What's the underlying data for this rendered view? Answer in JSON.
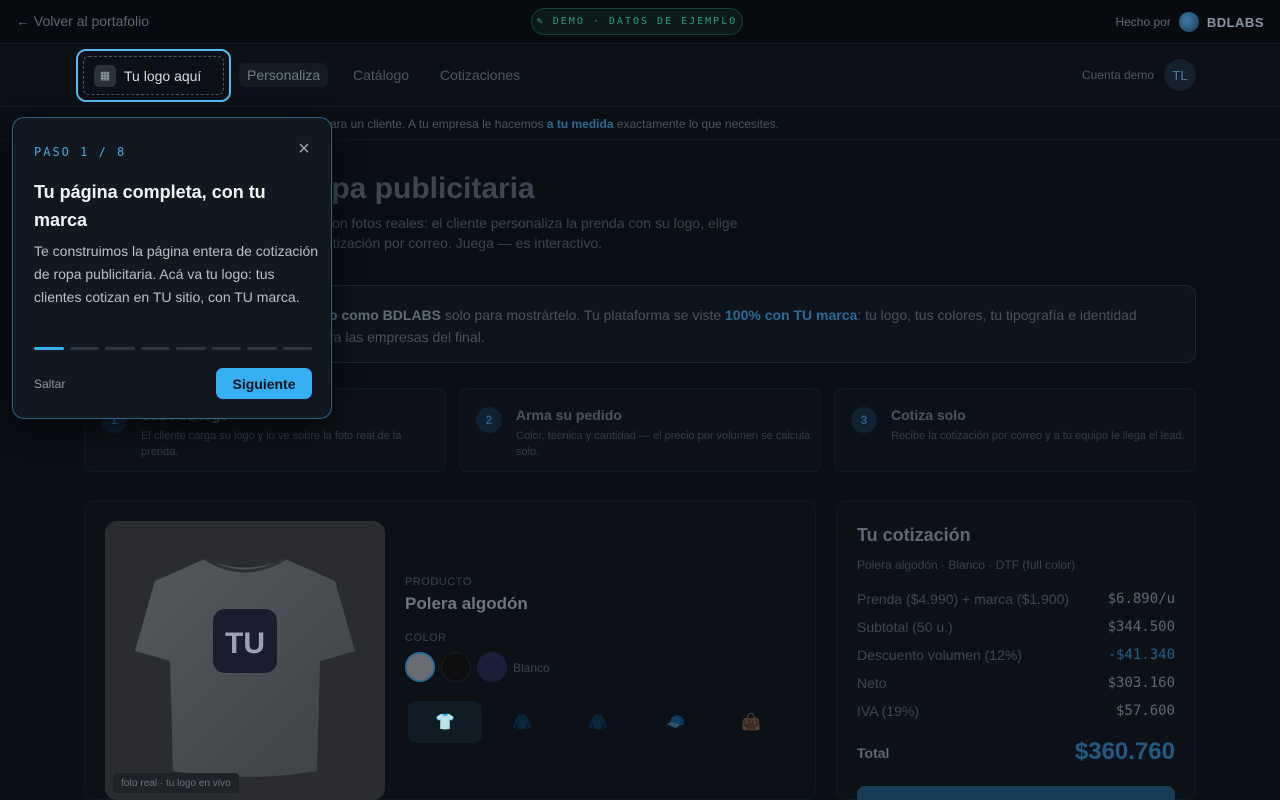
{
  "topbar": {
    "back_label": "← Volver al portafolio",
    "demo_badge": "DEMO · DATOS DE EJEMPLO",
    "made_by": "Hecho por",
    "brand": "BDLABS"
  },
  "nav": {
    "logo_placeholder": "Tu logo aquí",
    "items": [
      "Personaliza",
      "Catálogo",
      "Cotizaciones"
    ],
    "account": "Cuenta demo",
    "avatar_initials": "TL"
  },
  "notice": {
    "text_a": "s para un cliente. A tu empresa le hacemos ",
    "text_b": "a tu medida",
    "text_c": " exactamente lo que necesites."
  },
  "hero": {
    "title": "opa publicitaria",
    "subtitle_a": "con fotos reales: el cliente personaliza la prenda con su logo, elige",
    "subtitle_b": "otización por correo. Juega — es interactivo."
  },
  "banner": {
    "a": "o como BDLABS",
    "b": " solo para mostrártelo. Tu plataforma se viste ",
    "c": "100% con TU marca",
    "d": ": tu logo, tus colores, tu tipografía e identidad",
    "e": "ra las empresas del final."
  },
  "steps": [
    {
      "num": "1",
      "title": "Sube su logo",
      "desc": "El cliente carga su logo y lo ve sobre la foto real de la prenda."
    },
    {
      "num": "2",
      "title": "Arma su pedido",
      "desc": "Color, técnica y cantidad — el precio por volumen se calcula solo."
    },
    {
      "num": "3",
      "title": "Cotiza solo",
      "desc": "Recibe la cotización por correo y a tu equipo le llega el lead."
    }
  ],
  "product": {
    "photo_tag": "foto real · tu logo en vivo",
    "logo_text": "TU",
    "label": "PRODUCTO",
    "name": "Polera algodón",
    "color_label": "COLOR",
    "color_name": "Blanco"
  },
  "quote": {
    "title": "Tu cotización",
    "subtitle": "Polera algodón · Blanco · DTF (full color)",
    "rows": [
      {
        "label": "Prenda ($4.990) + marca ($1.900)",
        "value": "$6.890/u"
      },
      {
        "label": "Subtotal (50 u.)",
        "value": "$344.500"
      },
      {
        "label": "Descuento volumen (12%)",
        "value": "-$41.340"
      },
      {
        "label": "Neto",
        "value": "$303.160"
      },
      {
        "label": "IVA (19%)",
        "value": "$57.600"
      }
    ],
    "total_label": "Total",
    "total_value": "$360.760"
  },
  "tour": {
    "step_label": "PASO 1 / 8",
    "title": "Tu página completa, con tu marca",
    "body": "Te construimos la página entera de cotización de ropa publicitaria. Acá va tu logo: tus clientes cotizan en TU sitio, con TU marca.",
    "progress": {
      "current": 1,
      "total": 8
    },
    "skip_label": "Saltar",
    "next_label": "Siguiente"
  },
  "colors": {
    "accent": "#36b0f2",
    "background": "#0a0f16"
  }
}
